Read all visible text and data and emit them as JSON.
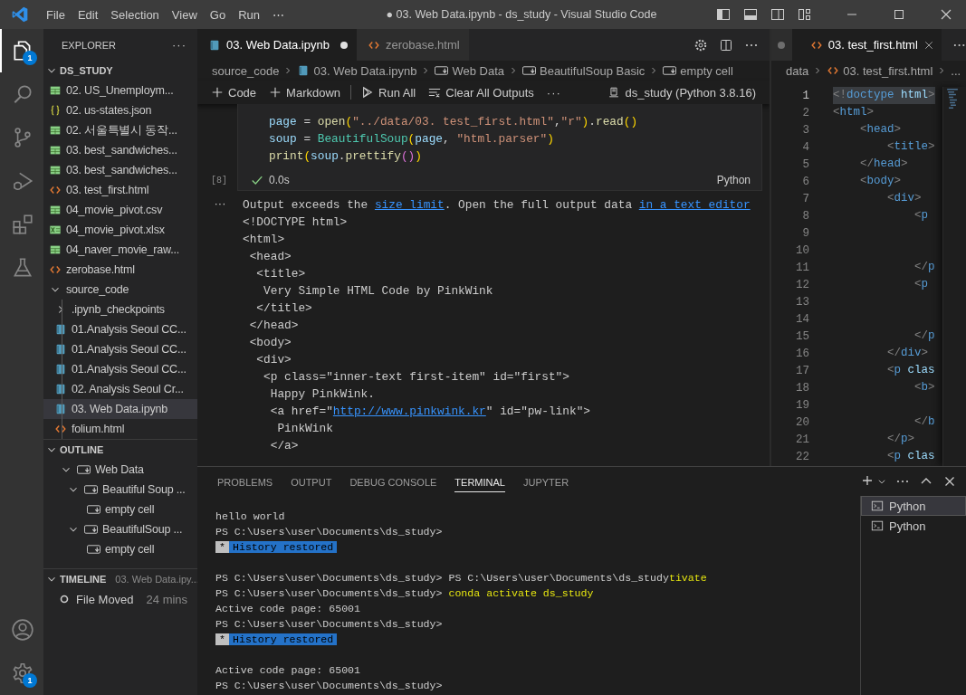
{
  "title_bar": {
    "menu": [
      "File",
      "Edit",
      "Selection",
      "View",
      "Go",
      "Run",
      "⋯"
    ],
    "title": "● 03. Web Data.ipynb - ds_study - Visual Studio Code"
  },
  "activity_bar": {
    "items": [
      {
        "kind": "explorer",
        "selected": true,
        "badge": "1"
      },
      {
        "kind": "search",
        "selected": false
      },
      {
        "kind": "scm",
        "selected": false
      },
      {
        "kind": "debug",
        "selected": false
      },
      {
        "kind": "extensions",
        "selected": false
      },
      {
        "kind": "testing",
        "selected": false
      }
    ],
    "bottom": [
      {
        "kind": "account"
      },
      {
        "kind": "manage",
        "badge": "1"
      }
    ]
  },
  "explorer": {
    "title": "EXPLORER",
    "more": "···",
    "root": {
      "name": "DS_STUDY",
      "expanded": true,
      "children": [
        {
          "name": "02. US_Unemploym...",
          "kind": "csv",
          "selected": false
        },
        {
          "name": "02. us-states.json",
          "kind": "json",
          "selected": false
        },
        {
          "name": "02. 서울특별시 동작...",
          "kind": "csv",
          "selected": false
        },
        {
          "name": "03. best_sandwiches...",
          "kind": "csv",
          "selected": false
        },
        {
          "name": "03. best_sandwiches...",
          "kind": "csv",
          "selected": false
        },
        {
          "name": "03. test_first.html",
          "kind": "html",
          "selected": false
        },
        {
          "name": "04_movie_pivot.csv",
          "kind": "csv",
          "selected": false
        },
        {
          "name": "04_movie_pivot.xlsx",
          "kind": "xlsx",
          "selected": false
        },
        {
          "name": "04_naver_movie_raw...",
          "kind": "csv",
          "selected": false
        },
        {
          "name": "zerobase.html",
          "kind": "html",
          "selected": false
        },
        {
          "name": "source_code",
          "kind": "folder",
          "expanded": true,
          "selected": false,
          "children": [
            {
              "name": ".ipynb_checkpoints",
              "kind": "folder",
              "expanded": false,
              "selected": false
            },
            {
              "name": "01.Analysis Seoul CC...",
              "kind": "notebook",
              "selected": false
            },
            {
              "name": "01.Analysis Seoul CC...",
              "kind": "notebook",
              "selected": false
            },
            {
              "name": "01.Analysis Seoul CC...",
              "kind": "notebook",
              "selected": false
            },
            {
              "name": "02. Analysis Seoul Cr...",
              "kind": "notebook",
              "selected": false
            },
            {
              "name": "03. Web Data.ipynb",
              "kind": "notebook",
              "selected": true
            },
            {
              "name": "folium.html",
              "kind": "html",
              "selected": false
            }
          ]
        }
      ]
    }
  },
  "outline": {
    "title": "OUTLINE",
    "expanded": true,
    "items": [
      {
        "name": "Web Data",
        "expanded": true,
        "children": [
          {
            "name": "Beautiful Soup ...",
            "expanded": true,
            "children": [
              {
                "name": "empty cell"
              }
            ]
          },
          {
            "name": "BeautifulSoup ...",
            "expanded": true,
            "children": [
              {
                "name": "empty cell"
              }
            ]
          }
        ]
      }
    ]
  },
  "timeline": {
    "title": "TIMELINE",
    "file": "03. Web Data.ipy...",
    "expanded": true,
    "items": [
      {
        "event": "File Moved",
        "time": "24 mins"
      }
    ]
  },
  "notebook": {
    "tabs": [
      {
        "label": "03. Web Data.ipynb",
        "kind": "notebook",
        "selected": true,
        "dirty": true
      },
      {
        "label": "zerobase.html",
        "kind": "html",
        "selected": false,
        "dirty": false
      }
    ],
    "breadcrumbs": [
      {
        "label": "source_code",
        "kind": "folder"
      },
      {
        "label": "03. Web Data.ipynb",
        "kind": "notebook"
      },
      {
        "label": "Web Data",
        "kind": "markdown"
      },
      {
        "label": "BeautifulSoup Basic",
        "kind": "markdown"
      },
      {
        "label": "empty cell",
        "kind": "markdown"
      }
    ],
    "toolbar": [
      {
        "label": "Code",
        "kind": "add"
      },
      {
        "label": "Markdown",
        "kind": "add"
      },
      {
        "label": "Run All",
        "kind": "run"
      },
      {
        "label": "Clear All Outputs",
        "kind": "clear"
      },
      {
        "label": "···",
        "kind": "more"
      }
    ],
    "kernel": "ds_study (Python 3.8.16)",
    "cell": {
      "code": [
        [
          {
            "text": "page",
            "kind": "var"
          },
          {
            "text": " = ",
            "kind": "op"
          },
          {
            "text": "open",
            "kind": "func"
          },
          {
            "text": "(",
            "kind": "paren"
          },
          {
            "text": "\"../data/03. test_first.html\"",
            "kind": "str"
          },
          {
            "text": ",",
            "kind": "op"
          },
          {
            "text": "\"r\"",
            "kind": "str"
          },
          {
            "text": ")",
            "kind": "paren"
          },
          {
            "text": ".",
            "kind": "op"
          },
          {
            "text": "read",
            "kind": "func"
          },
          {
            "text": "()",
            "kind": "paren"
          }
        ],
        [
          {
            "text": "soup",
            "kind": "var"
          },
          {
            "text": " = ",
            "kind": "op"
          },
          {
            "text": "BeautifulSoup",
            "kind": "class"
          },
          {
            "text": "(",
            "kind": "paren"
          },
          {
            "text": "page",
            "kind": "var"
          },
          {
            "text": ", ",
            "kind": "op"
          },
          {
            "text": "\"html.parser\"",
            "kind": "str"
          },
          {
            "text": ")",
            "kind": "paren"
          }
        ],
        [
          {
            "text": "print",
            "kind": "func"
          },
          {
            "text": "(",
            "kind": "paren"
          },
          {
            "text": "soup",
            "kind": "var"
          },
          {
            "text": ".",
            "kind": "op"
          },
          {
            "text": "prettify",
            "kind": "func"
          },
          {
            "text": "()",
            "kind": "paren2"
          },
          {
            "text": ")",
            "kind": "paren"
          }
        ]
      ],
      "execution_count": "[8]",
      "succeeded": true,
      "duration": "0.0s",
      "language": "Python"
    },
    "output_marker": "···",
    "output": [
      [
        {
          "text": "Output exceeds the ",
          "kind": "text"
        },
        {
          "text": "size limit",
          "kind": "link"
        },
        {
          "text": ". Open the full output data ",
          "kind": "text"
        },
        {
          "text": "in a text editor",
          "kind": "link"
        }
      ],
      [
        {
          "text": "<!DOCTYPE html>",
          "kind": "text"
        }
      ],
      [
        {
          "text": "<html>",
          "kind": "text"
        }
      ],
      [
        {
          "text": " <head>",
          "kind": "text"
        }
      ],
      [
        {
          "text": "  <title>",
          "kind": "text"
        }
      ],
      [
        {
          "text": "   Very Simple HTML Code by PinkWink",
          "kind": "text"
        }
      ],
      [
        {
          "text": "  </title>",
          "kind": "text"
        }
      ],
      [
        {
          "text": " </head>",
          "kind": "text"
        }
      ],
      [
        {
          "text": " <body>",
          "kind": "text"
        }
      ],
      [
        {
          "text": "  <div>",
          "kind": "text"
        }
      ],
      [
        {
          "text": "   <p class=\"inner-text first-item\" id=\"first\">",
          "kind": "text"
        }
      ],
      [
        {
          "text": "    Happy PinkWink.",
          "kind": "text"
        }
      ],
      [
        {
          "text": "    <a href=\"",
          "kind": "text"
        },
        {
          "text": "http://www.pinkwink.kr",
          "kind": "link"
        },
        {
          "text": "\" id=\"pw-link\">",
          "kind": "text"
        }
      ],
      [
        {
          "text": "     PinkWink",
          "kind": "text"
        }
      ],
      [
        {
          "text": "    </a>",
          "kind": "text"
        }
      ]
    ]
  },
  "html_editor": {
    "tabs": [
      {
        "label": "03. test_first.html",
        "kind": "html",
        "selected": true
      }
    ],
    "breadcrumbs": [
      {
        "label": "data",
        "kind": "folder"
      },
      {
        "label": "03. test_first.html",
        "kind": "html"
      },
      {
        "label": "...",
        "kind": "more"
      }
    ],
    "lines": [
      {
        "n": "1",
        "text": "<!doctype html>",
        "selected": true
      },
      {
        "n": "2",
        "text": "<html>",
        "selected": false
      },
      {
        "n": "3",
        "text": "    <head>",
        "selected": false
      },
      {
        "n": "4",
        "text": "        <title>",
        "selected": false
      },
      {
        "n": "5",
        "text": "    </head>",
        "selected": false
      },
      {
        "n": "6",
        "text": "    <body>",
        "selected": false
      },
      {
        "n": "7",
        "text": "        <div>",
        "selected": false
      },
      {
        "n": "8",
        "text": "            <p",
        "selected": false
      },
      {
        "n": "9",
        "selected": false
      },
      {
        "n": "10",
        "selected": false
      },
      {
        "n": "11",
        "text": "            </p",
        "selected": false
      },
      {
        "n": "12",
        "text": "            <p",
        "selected": false
      },
      {
        "n": "13",
        "selected": false
      },
      {
        "n": "14",
        "selected": false
      },
      {
        "n": "15",
        "text": "            </p",
        "selected": false
      },
      {
        "n": "16",
        "text": "        </div>",
        "selected": false
      },
      {
        "n": "17",
        "text": "        <p clas",
        "selected": false
      },
      {
        "n": "18",
        "text": "            <b>",
        "selected": false
      },
      {
        "n": "19",
        "selected": false
      },
      {
        "n": "20",
        "text": "            </b",
        "selected": false
      },
      {
        "n": "21",
        "text": "        </p>",
        "selected": false
      },
      {
        "n": "22",
        "text": "        <p clas",
        "selected": false
      }
    ]
  },
  "panel": {
    "tabs": [
      {
        "label": "PROBLEMS",
        "selected": false
      },
      {
        "label": "OUTPUT",
        "selected": false
      },
      {
        "label": "DEBUG CONSOLE",
        "selected": false
      },
      {
        "label": "TERMINAL",
        "selected": true
      },
      {
        "label": "JUPYTER",
        "selected": false
      }
    ],
    "terminal": [
      {
        "kind": "text",
        "segments": [
          {
            "text": "hello world",
            "kind": "text"
          }
        ]
      },
      {
        "kind": "text",
        "segments": [
          {
            "text": "PS C:\\Users\\user\\Documents\\ds_study>",
            "kind": "text"
          }
        ]
      },
      {
        "kind": "text",
        "segments": [
          {
            "text": "*",
            "kind": "marker"
          },
          {
            "text": "History restored",
            "kind": "badge"
          }
        ]
      },
      {
        "kind": "blank"
      },
      {
        "kind": "text",
        "segments": [
          {
            "text": "PS C:\\Users\\user\\Documents\\ds_study> PS C:\\Users\\user\\Documents\\ds_study",
            "kind": "text"
          },
          {
            "text": "tivate",
            "kind": "command"
          }
        ]
      },
      {
        "kind": "text",
        "segments": [
          {
            "text": "PS C:\\Users\\user\\Documents\\ds_study> ",
            "kind": "text"
          },
          {
            "text": "conda activate ds_study",
            "kind": "command"
          }
        ]
      },
      {
        "kind": "text",
        "segments": [
          {
            "text": "Active code page: 65001",
            "kind": "text"
          }
        ]
      },
      {
        "kind": "text",
        "segments": [
          {
            "text": "PS C:\\Users\\user\\Documents\\ds_study>",
            "kind": "text"
          }
        ]
      },
      {
        "kind": "text",
        "segments": [
          {
            "text": "*",
            "kind": "marker"
          },
          {
            "text": "History restored",
            "kind": "badge"
          }
        ]
      },
      {
        "kind": "blank"
      },
      {
        "kind": "text",
        "segments": [
          {
            "text": "Active code page: 65001",
            "kind": "text"
          }
        ]
      },
      {
        "kind": "text",
        "segments": [
          {
            "text": "PS C:\\Users\\user\\Documents\\ds_study>",
            "kind": "text"
          }
        ]
      }
    ],
    "terminals": [
      {
        "label": "Python",
        "selected": true
      },
      {
        "label": "Python",
        "selected": false
      }
    ]
  }
}
